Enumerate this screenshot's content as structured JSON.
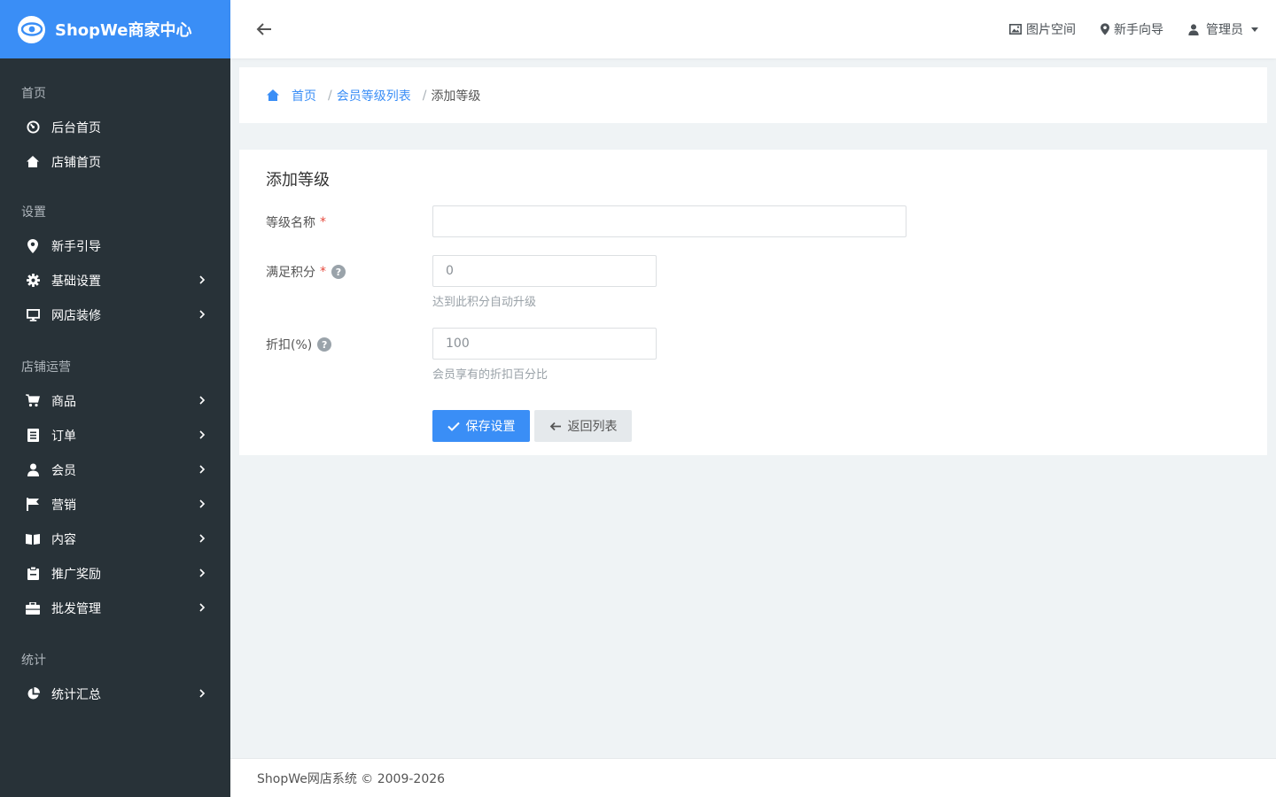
{
  "brand": {
    "name": "ShopWe商家中心"
  },
  "sidebar": {
    "groups": [
      {
        "title": "首页",
        "items": [
          {
            "label": "后台首页",
            "icon": "dashboard-icon"
          },
          {
            "label": "店铺首页",
            "icon": "home-icon"
          }
        ]
      },
      {
        "title": "设置",
        "items": [
          {
            "label": "新手引导",
            "icon": "map-marker-icon"
          },
          {
            "label": "基础设置",
            "icon": "gear-icon"
          },
          {
            "label": "网店装修",
            "icon": "monitor-icon"
          }
        ]
      },
      {
        "title": "店铺运营",
        "items": [
          {
            "label": "商品",
            "icon": "cart-icon"
          },
          {
            "label": "订单",
            "icon": "list-icon"
          },
          {
            "label": "会员",
            "icon": "user-icon"
          },
          {
            "label": "营销",
            "icon": "flag-icon"
          },
          {
            "label": "内容",
            "icon": "book-icon"
          },
          {
            "label": "推广奖励",
            "icon": "clipboard-icon"
          },
          {
            "label": "批发管理",
            "icon": "briefcase-icon"
          }
        ]
      },
      {
        "title": "统计",
        "items": [
          {
            "label": "统计汇总",
            "icon": "pie-chart-icon"
          }
        ]
      }
    ]
  },
  "header": {
    "links": {
      "image_space": "图片空间",
      "guide": "新手向导",
      "admin": "管理员"
    }
  },
  "breadcrumb": {
    "home": "首页",
    "list": "会员等级列表",
    "current": "添加等级",
    "separator": "/"
  },
  "form": {
    "title": "添加等级",
    "name": {
      "label": "等级名称",
      "required_mark": "*",
      "value": "",
      "placeholder": ""
    },
    "points": {
      "label": "满足积分",
      "required_mark": "*",
      "value": "",
      "placeholder": "0",
      "hint": "达到此积分自动升级",
      "help": "?"
    },
    "discount": {
      "label": "折扣(%)",
      "value": "",
      "placeholder": "100",
      "hint": "会员享有的折扣百分比",
      "help": "?"
    },
    "save_label": "保存设置",
    "back_label": "返回列表"
  },
  "footer": {
    "text": "ShopWe网店系统 © 2009-2026"
  },
  "colors": {
    "primary": "#3a8ef6",
    "sidebar_bg": "#283238",
    "page_bg": "#eff3f5"
  }
}
